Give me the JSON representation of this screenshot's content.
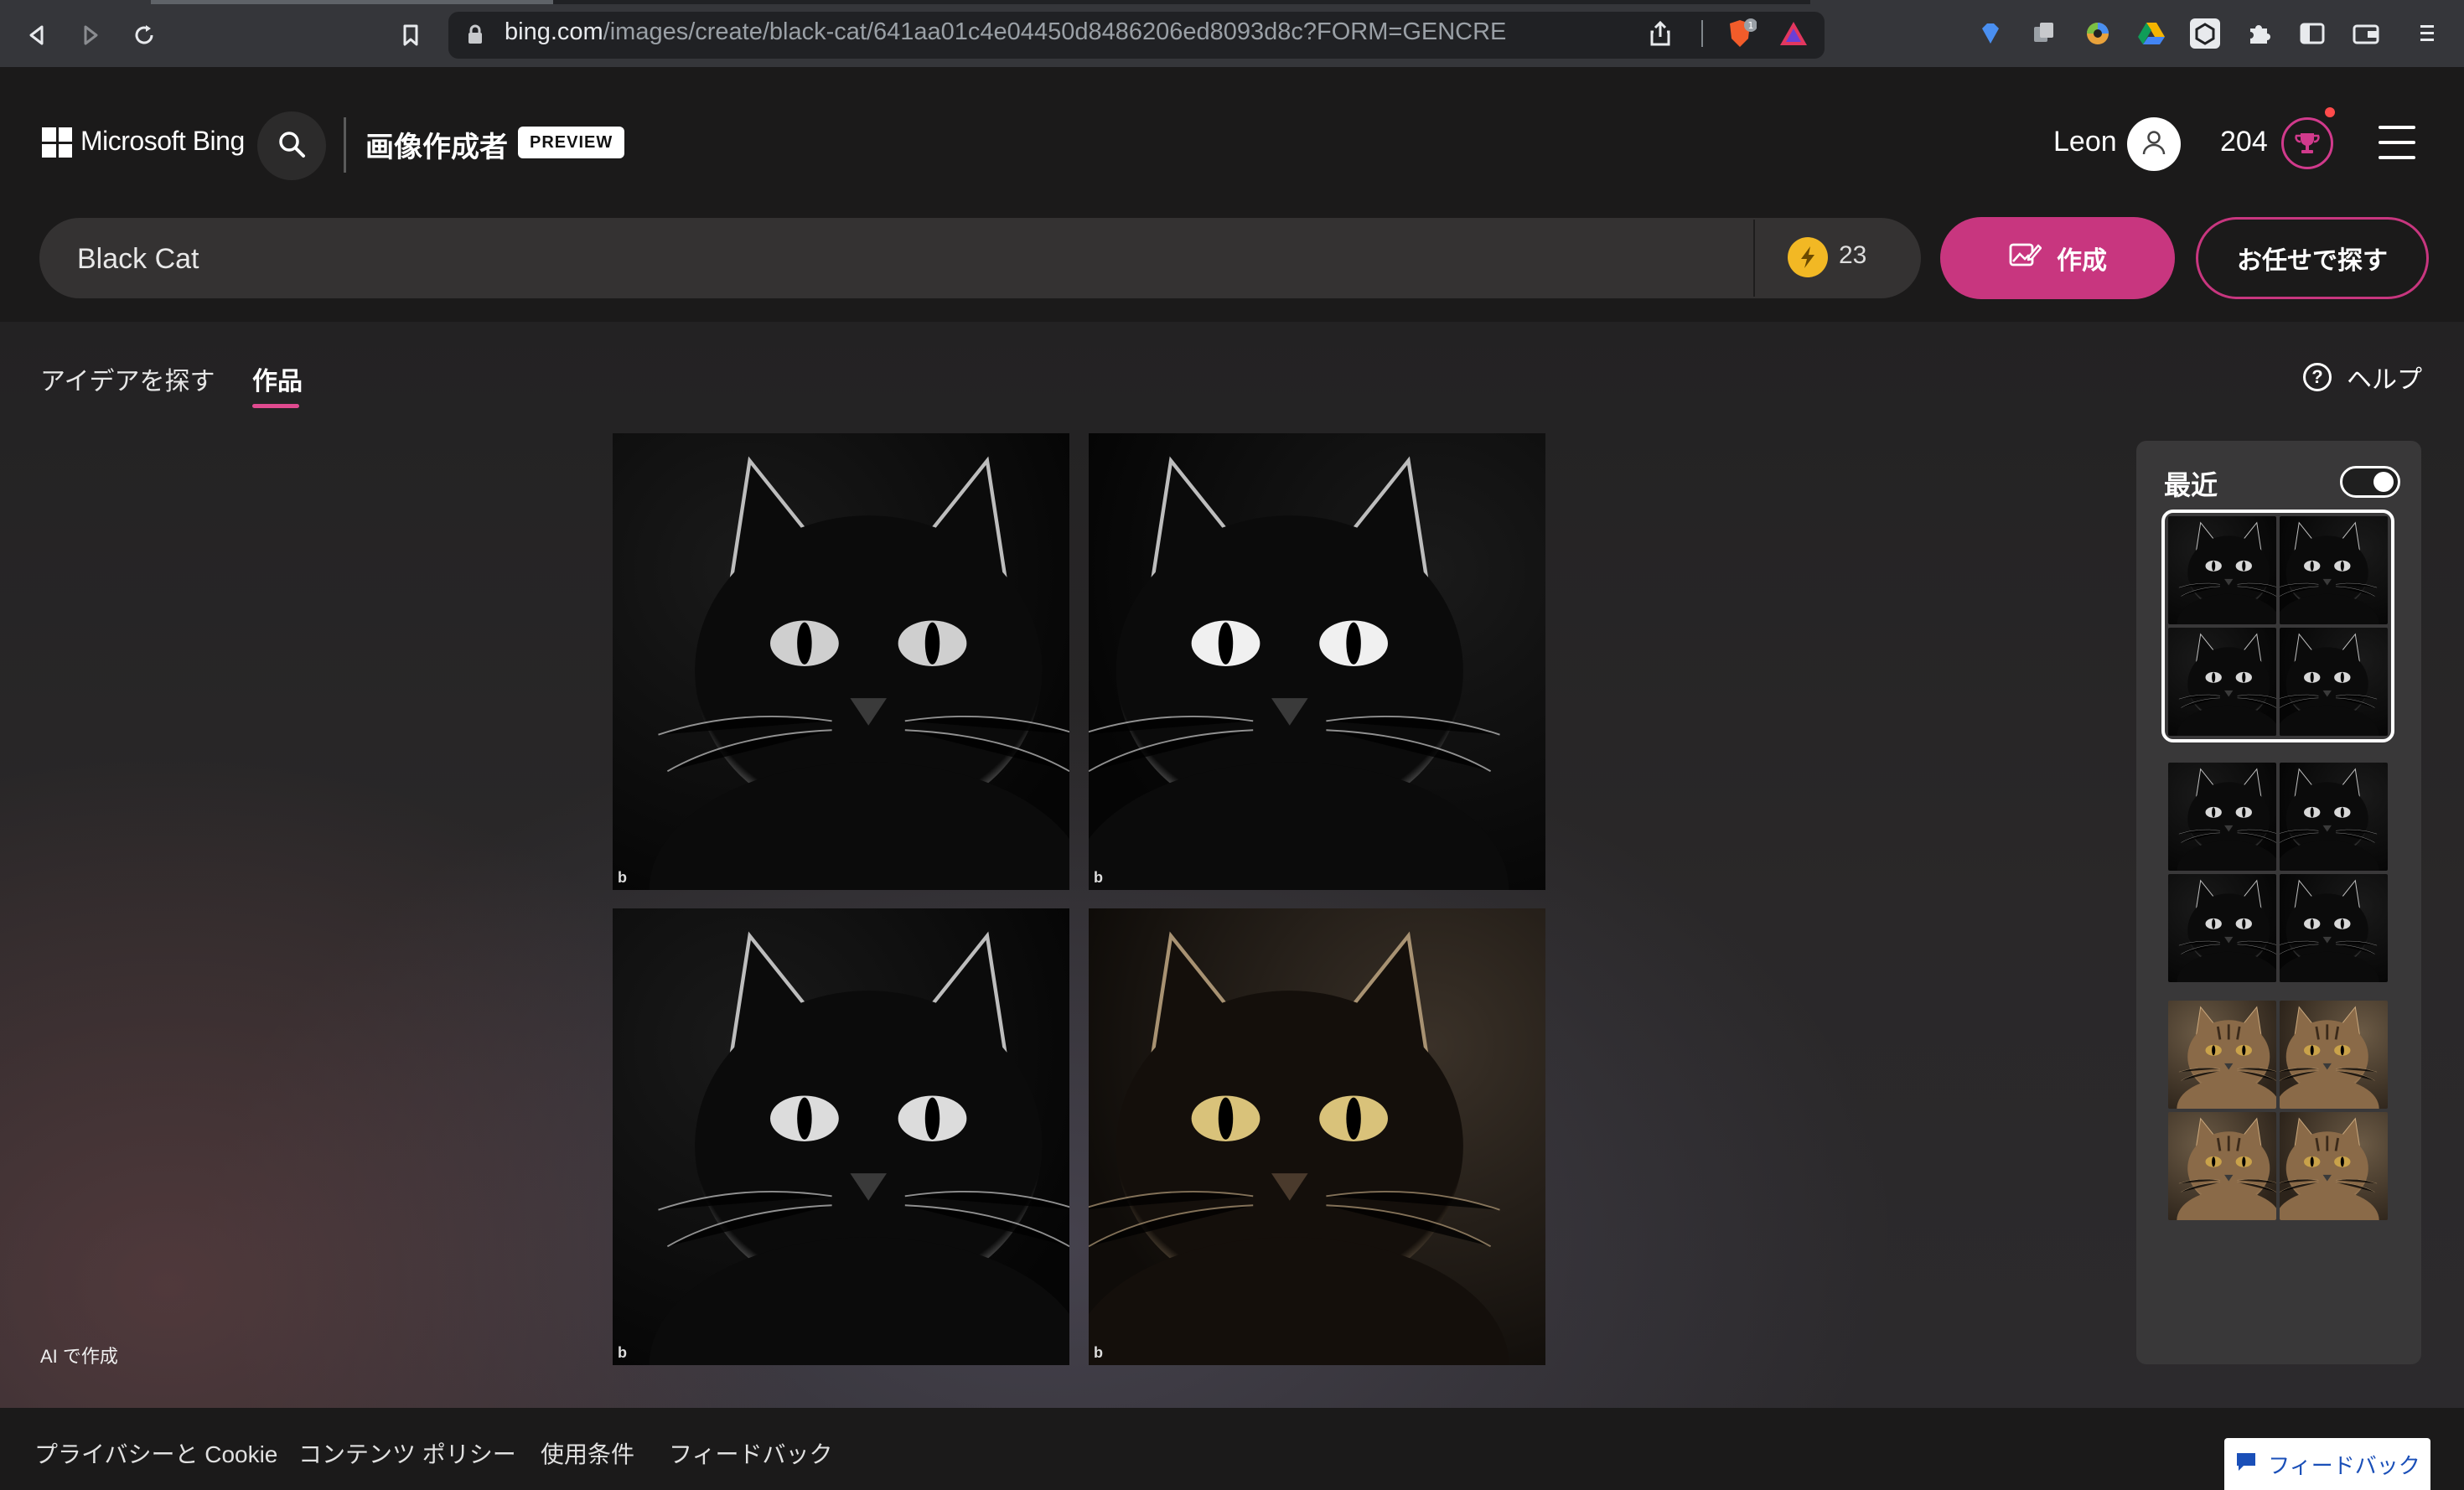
{
  "browser": {
    "url_host": "bing.com",
    "url_path": "/images/create/black-cat/641aa01c4e04450d8486206ed8093d8c?FORM=GENCRE"
  },
  "header": {
    "brand": "Microsoft Bing",
    "title": "画像作成者",
    "badge": "PREVIEW",
    "user_name": "Leon",
    "points": "204"
  },
  "prompt": {
    "value": "Black Cat",
    "boosts": "23",
    "create_label": "作成",
    "surprise_label": "お任せで探す"
  },
  "tabs": [
    {
      "label": "アイデアを探す",
      "active": false
    },
    {
      "label": "作品",
      "active": true
    }
  ],
  "help_label": "ヘルプ",
  "results": {
    "images": [
      {
        "subject": "black-cat",
        "tone": "monochrome",
        "eyes": "#cfcfcf"
      },
      {
        "subject": "black-cat",
        "tone": "monochrome",
        "eyes": "#f0f0f0"
      },
      {
        "subject": "black-cat",
        "tone": "monochrome",
        "eyes": "#dcdcdc"
      },
      {
        "subject": "black-cat",
        "tone": "sepia",
        "eyes": "#d9c27a"
      }
    ],
    "watermark": "b"
  },
  "ai_label": "AI で作成",
  "recent": {
    "title": "最近",
    "toggle_on": true,
    "sets": [
      {
        "selected": true,
        "style": "black-cat"
      },
      {
        "selected": false,
        "style": "black-cat"
      },
      {
        "selected": false,
        "style": "tabby-cat"
      }
    ]
  },
  "footer": {
    "links": [
      "プライバシーと Cookie",
      "コンテンツ ポリシー",
      "使用条件",
      "フィードバック"
    ],
    "feedback_tab": "フィードバック"
  },
  "colors": {
    "accent": "#c8367f",
    "boost": "#f2b824",
    "page_bg": "#1b1a1a"
  }
}
